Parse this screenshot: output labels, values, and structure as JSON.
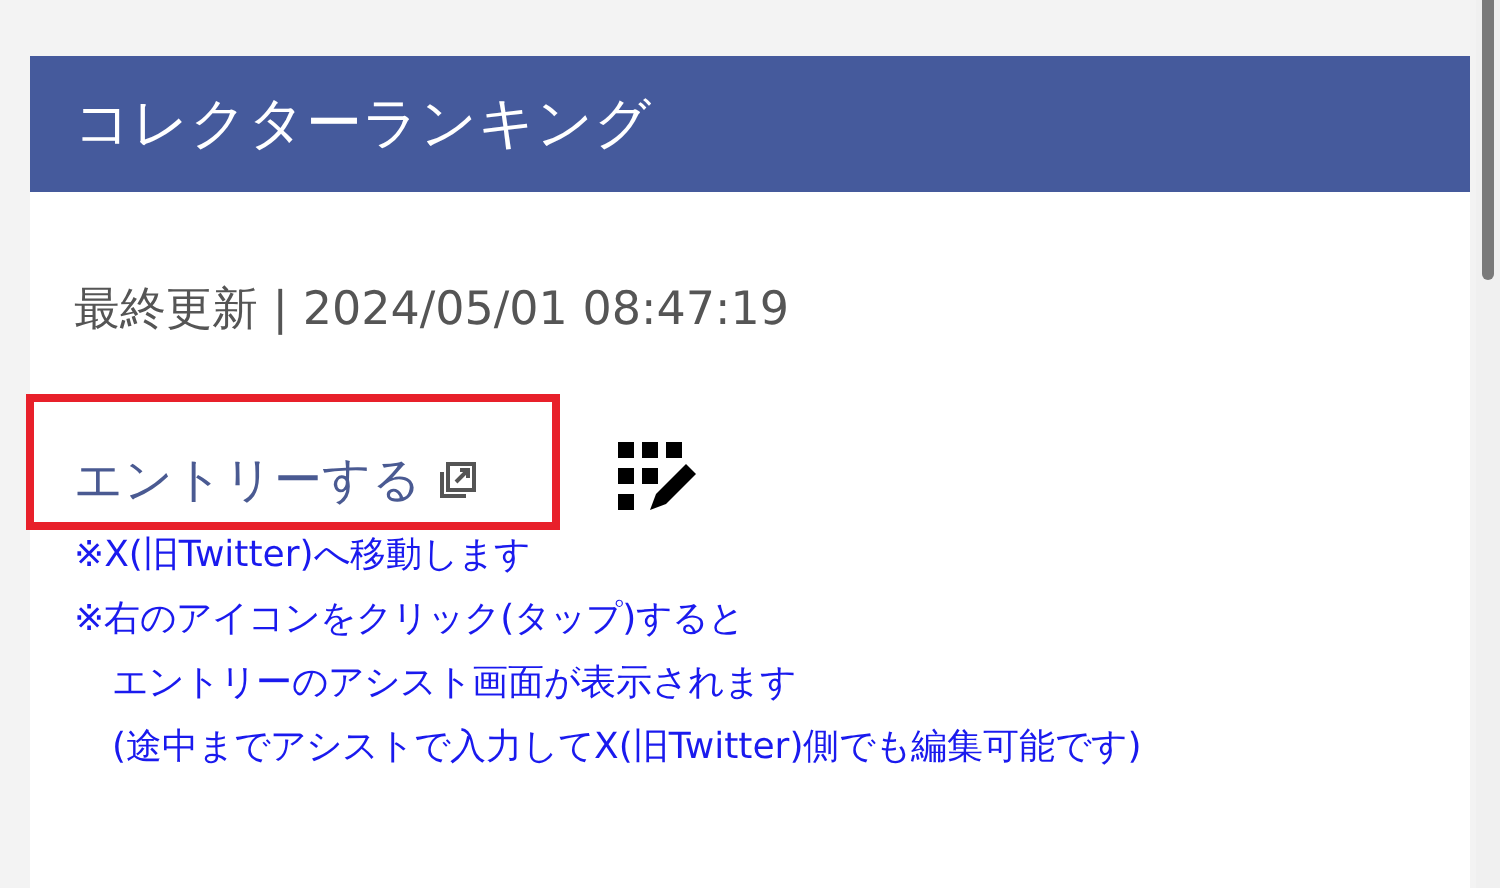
{
  "panel": {
    "title": "コレクターランキング"
  },
  "last_updated": "最終更新 | 2024/05/01 08:47:19",
  "entry_link": {
    "label": "エントリーする",
    "highlighted": true
  },
  "notes": [
    {
      "text": "※X(旧Twitter)へ移動します",
      "kind": "marked"
    },
    {
      "text": "※右のアイコンをクリック(タップ)すると",
      "kind": "marked"
    },
    {
      "text": "エントリーのアシスト画面が表示されます",
      "kind": "continuation"
    },
    {
      "text": "(途中までアシストで入力してX(旧Twitter)側でも編集可能です)",
      "kind": "continuation"
    }
  ]
}
